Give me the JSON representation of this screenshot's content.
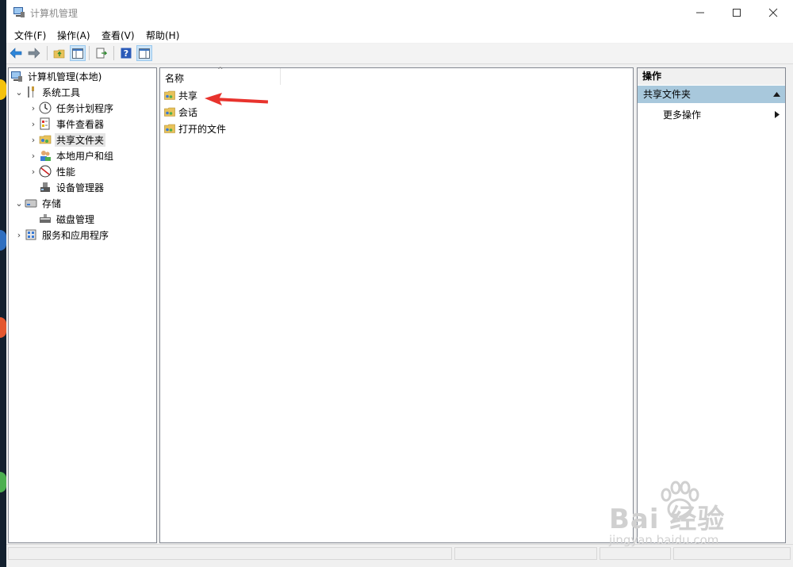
{
  "window": {
    "title": "计算机管理"
  },
  "menu": [
    "文件(F)",
    "操作(A)",
    "查看(V)",
    "帮助(H)"
  ],
  "toolbar": {
    "buttons": [
      "back-icon",
      "forward-icon",
      "up-folder-icon",
      "show-hide-tree-icon",
      "export-list-icon",
      "help-icon",
      "show-hide-action-pane-icon"
    ]
  },
  "tree": {
    "root": "计算机管理(本地)",
    "system_tools": "系统工具",
    "task_scheduler": "任务计划程序",
    "event_viewer": "事件查看器",
    "shared_folders": "共享文件夹",
    "local_users": "本地用户和组",
    "performance": "性能",
    "device_manager": "设备管理器",
    "storage": "存储",
    "disk_management": "磁盘管理",
    "services_apps": "服务和应用程序"
  },
  "list": {
    "column_header": "名称",
    "items": [
      "共享",
      "会话",
      "打开的文件"
    ]
  },
  "actions": {
    "header": "操作",
    "section": "共享文件夹",
    "more": "更多操作"
  },
  "watermark": {
    "brand": "Bai 经验",
    "url": "jingyan.baidu.com"
  },
  "colors": {
    "selection_bg": "#e5e5e5",
    "action_section_bg": "#a8c8dc",
    "annotation_arrow": "#e8332d"
  }
}
